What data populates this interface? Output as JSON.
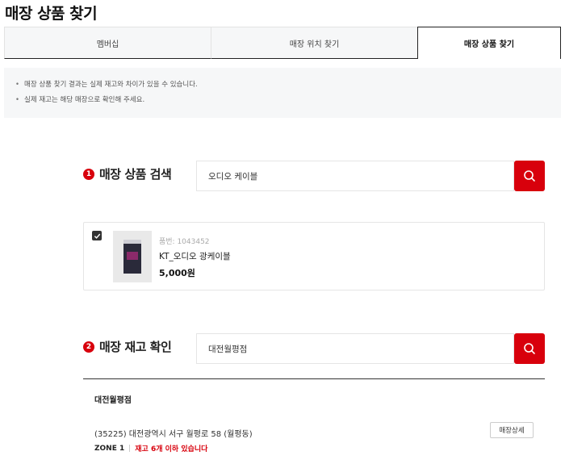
{
  "page": {
    "title": "매장 상품 찾기"
  },
  "tabs": [
    {
      "label": "멤버십"
    },
    {
      "label": "매장 위치 찾기"
    },
    {
      "label": "매장 상품 찾기"
    }
  ],
  "notice": {
    "items": [
      "매장 상품 찾기 결과는 실제 재고와 차이가 있을 수 있습니다.",
      "실제 재고는 해당 매장으로 확인해 주세요."
    ]
  },
  "step1": {
    "number": "1",
    "label": "매장 상품 검색",
    "search_value": "오디오 케이블",
    "search_icon": "search-icon"
  },
  "product": {
    "checked": true,
    "code": "품번: 1043452",
    "name": "KT_오디오 광케이블",
    "price": "5,000원"
  },
  "step2": {
    "number": "2",
    "label": "매장 재고 확인",
    "search_value": "대전월평점",
    "search_icon": "search-icon"
  },
  "store": {
    "name": "대전월평점",
    "address": "(35225) 대전광역시 서구 월평로 58 (월평동)",
    "zone": "ZONE 1",
    "stock": "재고 6개 이하 있습니다",
    "detail_button": "매장상세"
  },
  "colors": {
    "accent": "#d8000c",
    "notice_bg": "#f6f7f8"
  }
}
